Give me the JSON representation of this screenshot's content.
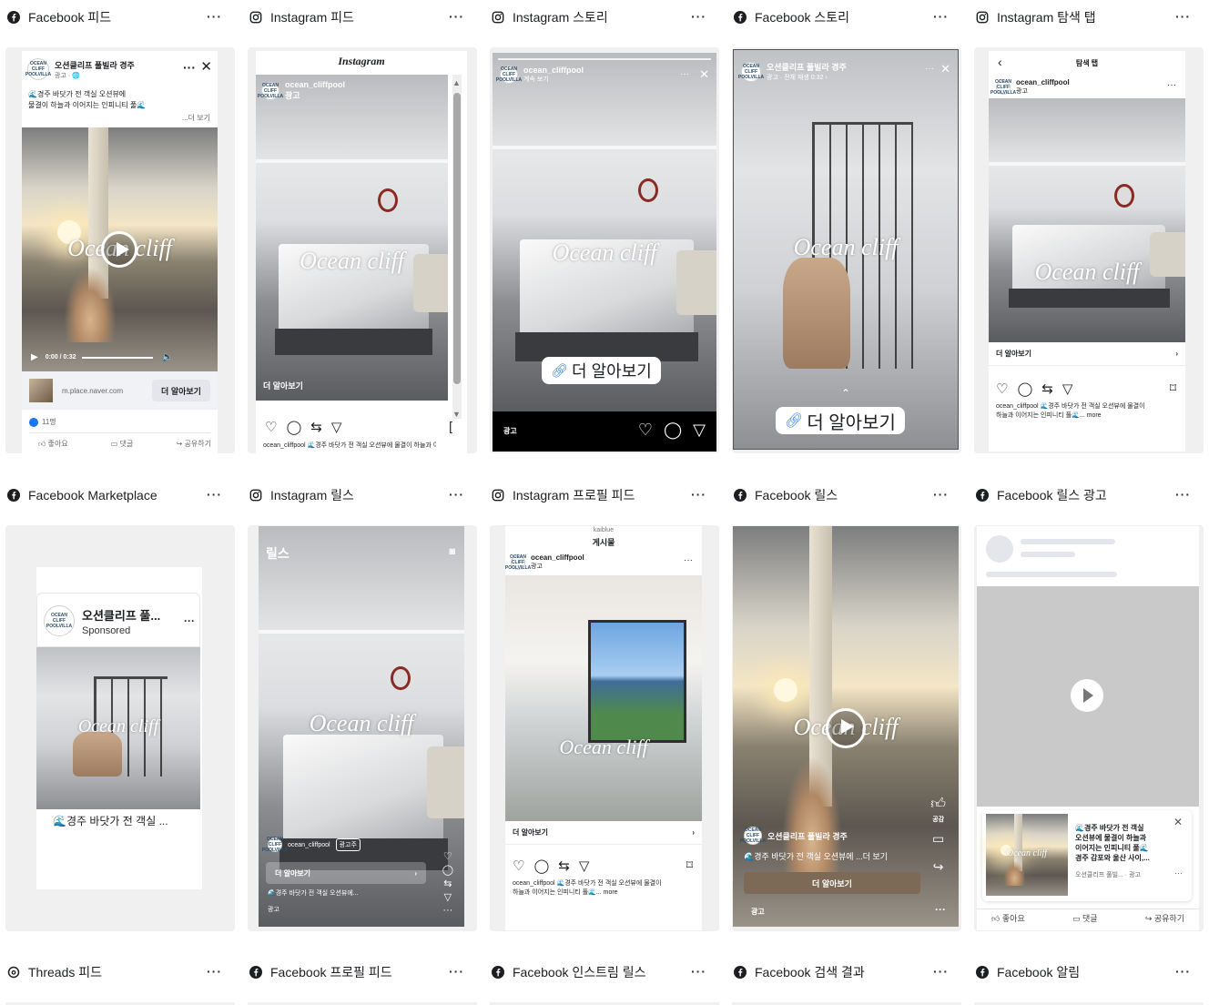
{
  "placements": [
    {
      "platform": "facebook",
      "title": "Facebook 피드"
    },
    {
      "platform": "instagram",
      "title": "Instagram 피드"
    },
    {
      "platform": "instagram",
      "title": "Instagram 스토리"
    },
    {
      "platform": "facebook",
      "title": "Facebook 스토리"
    },
    {
      "platform": "instagram",
      "title": "Instagram 탐색 탭"
    },
    {
      "platform": "facebook",
      "title": "Facebook Marketplace"
    },
    {
      "platform": "instagram",
      "title": "Instagram 릴스"
    },
    {
      "platform": "instagram",
      "title": "Instagram 프로필 피드"
    },
    {
      "platform": "facebook",
      "title": "Facebook 릴스"
    },
    {
      "platform": "facebook",
      "title": "Facebook 릴스 광고"
    },
    {
      "platform": "threads",
      "title": "Threads 피드"
    },
    {
      "platform": "facebook",
      "title": "Facebook 프로필 피드"
    },
    {
      "platform": "facebook",
      "title": "Facebook 인스트림 릴스"
    },
    {
      "platform": "facebook",
      "title": "Facebook 검색 결과"
    },
    {
      "platform": "facebook",
      "title": "Facebook 알림"
    }
  ],
  "more_label": "···",
  "brand": {
    "page_name": "오션클리프 풀빌라 경주",
    "page_name_short": "오션클리프 풀...",
    "ig_handle": "ocean_cliffpool",
    "logo_text": "OCEAN CLIFF POOLVILLA",
    "watermark": "Ocean cliff",
    "accent": "#5b4a3c"
  },
  "fb_feed": {
    "sub": "광고 · 🌐",
    "body1": "🌊경주 바닷가 전 객실 오션뷰에",
    "body2": "물결이 하늘과 이어지는 인피니티 풀🌊",
    "see_more": "...더 보기",
    "time": "0:00 / 0:32",
    "domain": "m.place.naver.com",
    "cta": "더 알아보기",
    "reactions": "11명",
    "like": "좋아요",
    "comment": "댓글",
    "share": "공유하기"
  },
  "ig_feed": {
    "app_name": "Instagram",
    "sub": "광고",
    "cta": "더 알아보기",
    "caption": "ocean_cliffpool 🌊경주 바닷가 전 객실 오션뷰에 물결이 하늘과 이어지는 인피니티 풀🌊"
  },
  "ig_story": {
    "sub": "계속 보기",
    "cta": "더 알아보기",
    "ad_label": "광고"
  },
  "fb_story": {
    "sub": "광고 · 전체 재생 0:32 ›",
    "cta": "더 알아보기"
  },
  "ig_explore": {
    "title": "탐색 탭",
    "sub": "광고",
    "cta": "더 알아보기",
    "caption": "ocean_cliffpool 🌊경주 바닷가 전 객실 오션뷰에 물결이 하늘과 이어지는 인피니티 풀🌊... more"
  },
  "fb_marketplace": {
    "sponsored": "Sponsored",
    "caption": "🌊경주 바닷가 전 객실 ..."
  },
  "ig_reels": {
    "title": "릴스",
    "badge": "광고주",
    "cta": "더 알아보기",
    "caption": "🌊경주 바닷가 전 객실 오션뷰에...",
    "ad_label": "광고"
  },
  "ig_profile": {
    "account": "kaiblue",
    "title": "게시물",
    "sub": "광고",
    "cta": "더 알아보기",
    "caption": "ocean_cliffpool 🌊경주 바닷가 전 객실 오션뷰에 물결이 하늘과 이어지는 인피니티 풀🌊... more"
  },
  "fb_reels": {
    "page": "오션클리프 풀빌라 경주",
    "caption": "🌊경주 바닷가 전 객실 오션뷰에 ...더 보기",
    "cta": "더 알아보기",
    "ad_label": "광고",
    "like_label": "공감"
  },
  "fb_reels_ad": {
    "text1": "🌊경주 바닷가 전 객실",
    "text2": "오션뷰에 물결이 하늘과",
    "text3": "이어지는 인피니티 풀🌊",
    "text4": "경주 감포와 울산 사이,...",
    "meta": "오션클리프 풀빌... · 광고",
    "like": "좋아요",
    "comment": "댓글",
    "share": "공유하기"
  }
}
